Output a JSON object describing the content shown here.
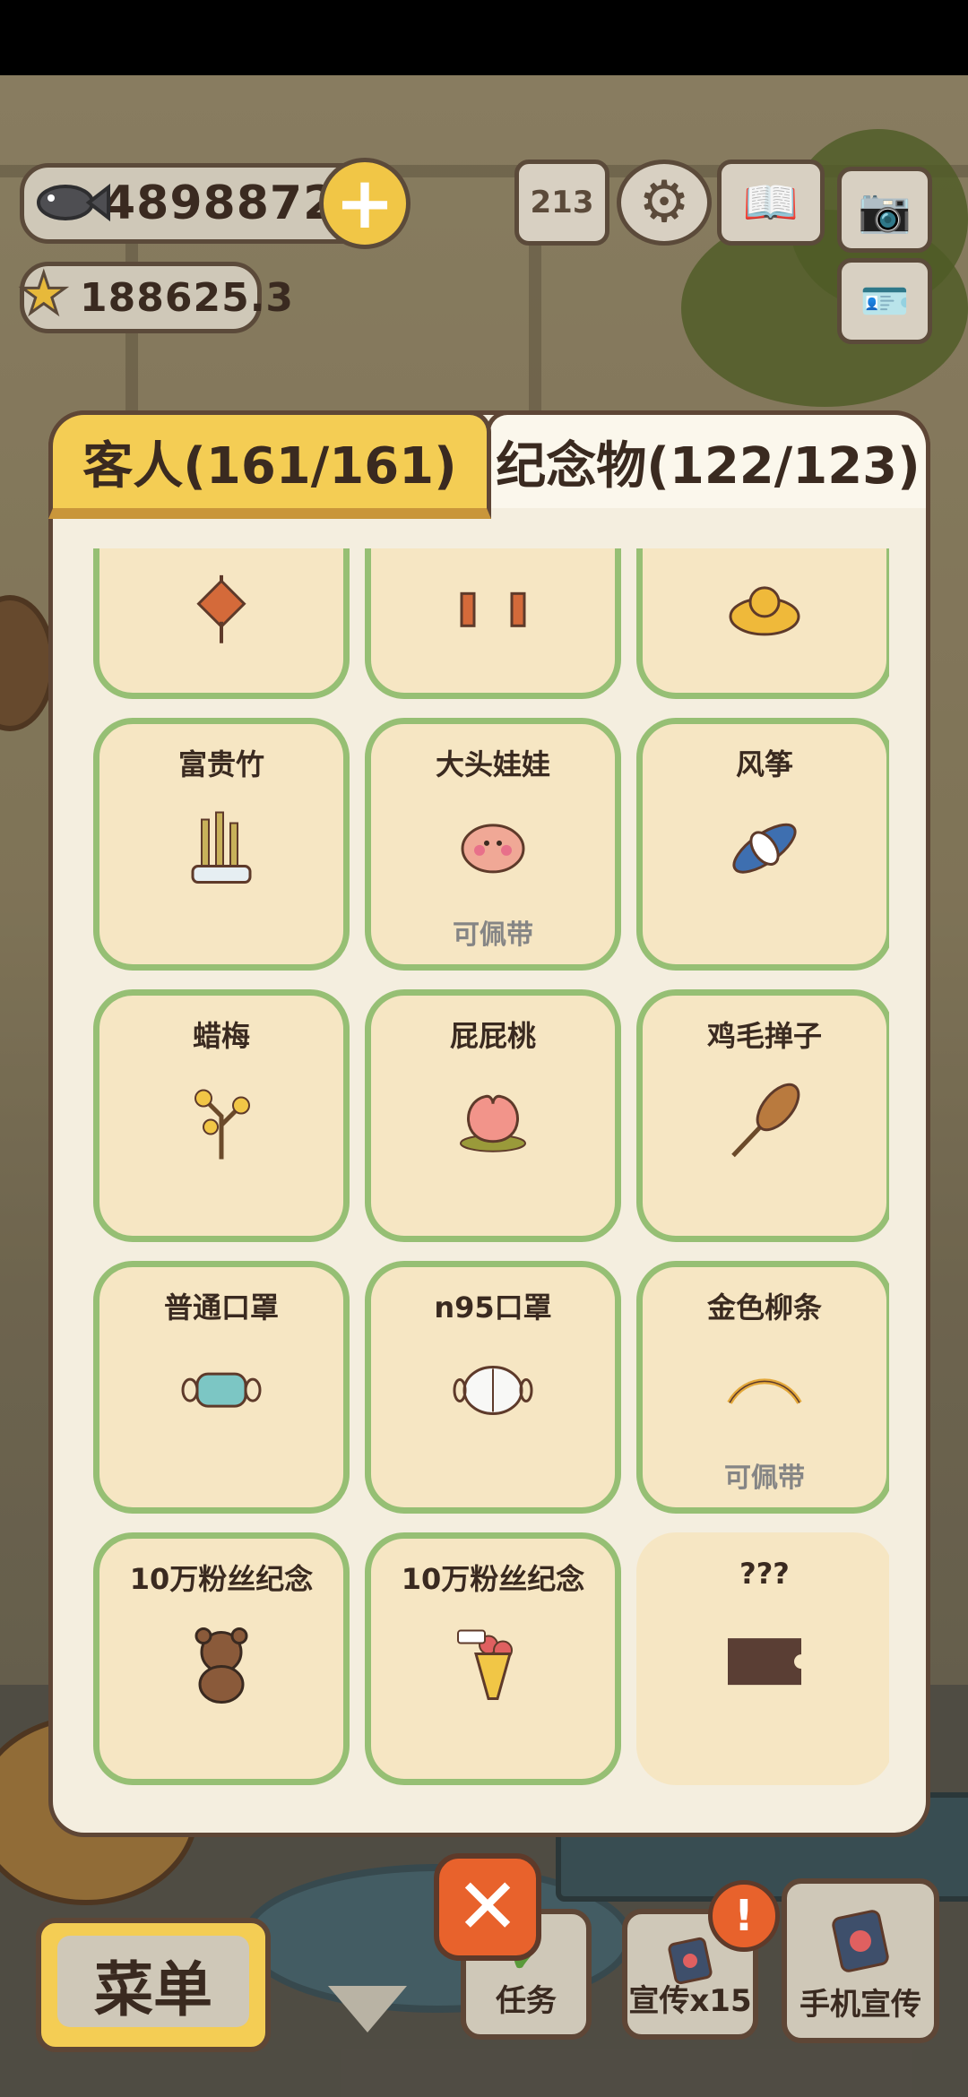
{
  "hud": {
    "fish_amount": "48988726",
    "star_amount": "188625.3",
    "icons": [
      "fish-icon",
      "star-icon",
      "plus-icon",
      "leaderboard-icon",
      "gear-icon",
      "guestbook-icon",
      "camera-icon",
      "profile-card-icon"
    ],
    "leaderboard_label": "213"
  },
  "tabs": {
    "guests": "客人(161/161)",
    "souvenirs": "纪念物(122/123)"
  },
  "items": [
    {
      "name": "",
      "wearable": "",
      "icon": "knot-ornament-icon"
    },
    {
      "name": "",
      "wearable": "",
      "icon": "couplet-icon"
    },
    {
      "name": "",
      "wearable": "",
      "icon": "gold-ingot-icon"
    },
    {
      "name": "富贵竹",
      "wearable": "",
      "icon": "lucky-bamboo-icon"
    },
    {
      "name": "大头娃娃",
      "wearable": "可佩带",
      "icon": "big-head-doll-icon"
    },
    {
      "name": "风筝",
      "wearable": "",
      "icon": "kite-icon"
    },
    {
      "name": "蜡梅",
      "wearable": "",
      "icon": "wintersweet-icon"
    },
    {
      "name": "屁屁桃",
      "wearable": "",
      "icon": "peach-icon"
    },
    {
      "name": "鸡毛掸子",
      "wearable": "",
      "icon": "feather-duster-icon"
    },
    {
      "name": "普通口罩",
      "wearable": "",
      "icon": "mask-icon"
    },
    {
      "name": "n95口罩",
      "wearable": "",
      "icon": "n95-mask-icon"
    },
    {
      "name": "金色柳条",
      "wearable": "可佩带",
      "icon": "golden-willow-icon"
    },
    {
      "name": "10万粉丝纪念",
      "wearable": "",
      "icon": "bear-icon"
    },
    {
      "name": "10万粉丝纪念",
      "wearable": "",
      "icon": "bouquet-icon"
    },
    {
      "name": "???",
      "wearable": "",
      "icon": "locked-ticket-icon"
    }
  ],
  "bottom": {
    "menu": "菜单",
    "task": "任务",
    "promote": "宣传x15",
    "phone_promote": "手机宣传",
    "alert": "!"
  },
  "colors": {
    "card_border": "#96bf74",
    "card_bg": "#f6e6c3",
    "tab_active": "#f4cd54",
    "close_button": "#e8622c"
  }
}
